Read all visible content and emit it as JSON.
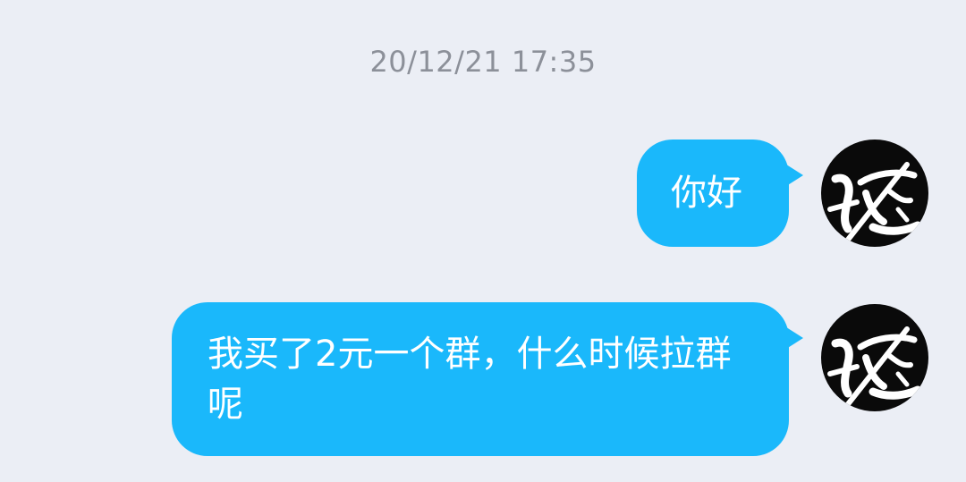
{
  "conversation": {
    "timestamp": "20/12/21 17:35",
    "messages": [
      {
        "text": "你好",
        "sender": "self"
      },
      {
        "text": "我买了2元一个群，什么时候拉群呢",
        "sender": "self"
      }
    ]
  },
  "icons": {
    "avatar": "calligraphy-logo-icon"
  },
  "colors": {
    "background": "#ebeef5",
    "bubble": "#1ab8fb",
    "bubble_text": "#ffffff",
    "timestamp_text": "#8c9099",
    "avatar_bg": "#0a0a0a"
  }
}
